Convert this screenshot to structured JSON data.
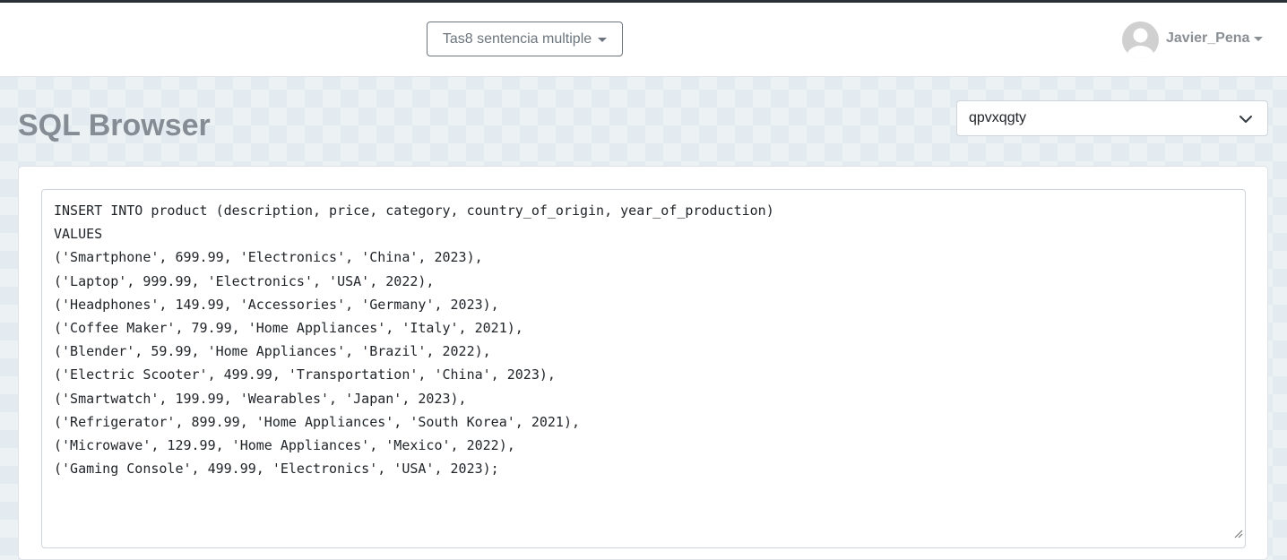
{
  "navbar": {
    "project_label": "Tas8 sentencia multiple",
    "user_name": "Javier_Pena"
  },
  "page": {
    "title": "SQL Browser"
  },
  "db_select": {
    "value": "qpvxqgty"
  },
  "editor": {
    "lines": [
      "INSERT INTO product (description, price, category, country_of_origin, year_of_production)",
      "VALUES",
      "('Smartphone', 699.99, 'Electronics', 'China', 2023),",
      "('Laptop', 999.99, 'Electronics', 'USA', 2022),",
      "('Headphones', 149.99, 'Accessories', 'Germany', 2023),",
      "('Coffee Maker', 79.99, 'Home Appliances', 'Italy', 2021),",
      "('Blender', 59.99, 'Home Appliances', 'Brazil', 2022),",
      "('Electric Scooter', 499.99, 'Transportation', 'China', 2023),",
      "('Smartwatch', 199.99, 'Wearables', 'Japan', 2023),",
      "('Refrigerator', 899.99, 'Home Appliances', 'South Korea', 2021),",
      "('Microwave', 129.99, 'Home Appliances', 'Mexico', 2022),",
      "('Gaming Console', 499.99, 'Electronics', 'USA', 2023);"
    ]
  },
  "icons": {
    "project_caret": "caret-down-icon",
    "user_caret": "caret-down-icon",
    "avatar": "user-avatar-icon",
    "select_chevron": "chevron-down-icon",
    "resize": "resize-grip-icon"
  }
}
